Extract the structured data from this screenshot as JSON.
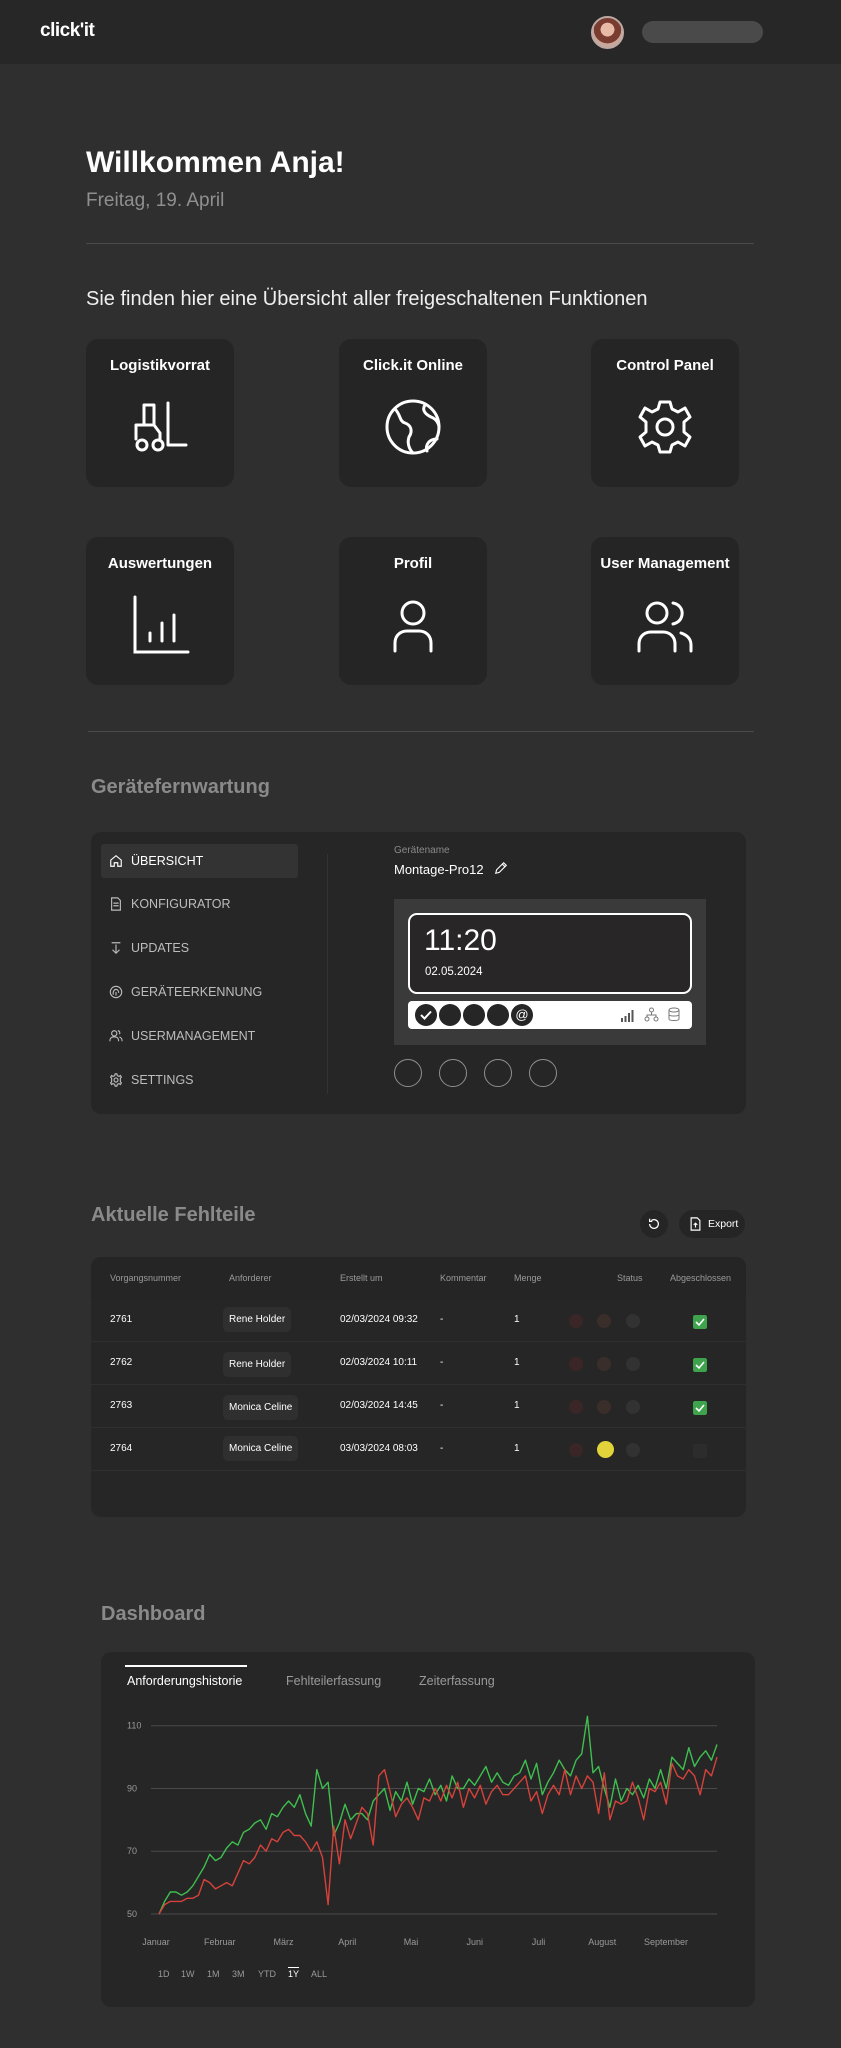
{
  "header": {
    "logo": "click'it",
    "user_pill": ""
  },
  "welcome": {
    "title": "Willkommen Anja!",
    "date": "Freitag, 19. April",
    "intro": "Sie finden hier eine Übersicht aller freigeschaltenen Funktionen"
  },
  "tiles": [
    {
      "label": "Logistikvorrat",
      "icon": "forklift-icon"
    },
    {
      "label": "Click.it Online",
      "icon": "globe-icon"
    },
    {
      "label": "Control Panel",
      "icon": "gear-icon"
    },
    {
      "label": "Auswertungen",
      "icon": "bar-chart-icon"
    },
    {
      "label": "Profil",
      "icon": "user-icon"
    },
    {
      "label": "User Management",
      "icon": "users-icon"
    }
  ],
  "remote": {
    "title": "Gerätefernwartung",
    "menu": [
      {
        "label": "ÜBERSICHT",
        "icon": "home-icon",
        "active": true
      },
      {
        "label": "KONFIGURATOR",
        "icon": "document-icon",
        "active": false
      },
      {
        "label": "UPDATES",
        "icon": "download-icon",
        "active": false
      },
      {
        "label": "GERÄTEERKENNUNG",
        "icon": "fingerprint-icon",
        "active": false
      },
      {
        "label": "USERMANAGEMENT",
        "icon": "users-icon",
        "active": false
      },
      {
        "label": "SETTINGS",
        "icon": "gear-icon",
        "active": false
      }
    ],
    "device_label": "Gerätename",
    "device_name": "Montage-Pro12",
    "clock_time": "11:20",
    "clock_date": "02.05.2024",
    "status_at": "@"
  },
  "parts": {
    "title": "Aktuelle Fehlteile",
    "export_label": "Export",
    "columns": [
      "Vorgangsnummer",
      "Anforderer",
      "Erstellt um",
      "Kommentar",
      "Menge",
      "Status",
      "Abgeschlossen"
    ],
    "rows": [
      {
        "id": "2761",
        "requester": "Rene Holder",
        "created": "02/03/2024 09:32",
        "comment": "-",
        "qty": "1",
        "status": "none",
        "done": true
      },
      {
        "id": "2762",
        "requester": "Rene Holder",
        "created": "02/03/2024 10:11",
        "comment": "-",
        "qty": "1",
        "status": "none",
        "done": true
      },
      {
        "id": "2763",
        "requester": "Monica Celine",
        "created": "02/03/2024 14:45",
        "comment": "-",
        "qty": "1",
        "status": "none",
        "done": true
      },
      {
        "id": "2764",
        "requester": "Monica Celine",
        "created": "03/03/2024 08:03",
        "comment": "-",
        "qty": "1",
        "status": "yellow",
        "done": false
      }
    ],
    "colors": {
      "check": "#3fa34d",
      "yellow": "#e3d33a"
    }
  },
  "dashboard": {
    "title": "Dashboard",
    "tabs": [
      "Anforderungshistorie",
      "Fehlteilerfassung",
      "Zeiterfassung"
    ],
    "ranges": [
      "1D",
      "1W",
      "1M",
      "3M",
      "YTD",
      "1Y",
      "ALL"
    ],
    "active_range": "1Y"
  },
  "chart_data": {
    "type": "line",
    "x_labels": [
      "Januar",
      "Februar",
      "März",
      "April",
      "Mai",
      "Juni",
      "Juli",
      "August",
      "September"
    ],
    "ylim": [
      50,
      115
    ],
    "yticks": [
      50,
      70,
      90,
      110
    ],
    "grid": true,
    "series": [
      {
        "color": "#3fbf4f",
        "values": [
          50,
          54,
          57,
          57,
          56,
          57,
          59,
          62,
          65,
          69,
          67,
          68,
          71,
          73,
          72,
          76,
          77,
          79,
          80,
          77,
          82,
          81,
          84,
          86,
          84,
          88,
          82,
          78,
          96,
          90,
          92,
          75,
          79,
          85,
          80,
          82,
          82,
          80,
          86,
          88,
          90,
          83,
          89,
          86,
          92,
          85,
          90,
          89,
          93,
          88,
          91,
          86,
          94,
          90,
          90,
          93,
          91,
          94,
          97,
          92,
          95,
          92,
          91,
          94,
          95,
          99,
          93,
          98,
          88,
          92,
          95,
          99,
          96,
          94,
          99,
          101,
          113,
          95,
          97,
          90,
          84,
          93,
          86,
          90,
          88,
          91,
          87,
          93,
          90,
          96,
          90,
          100,
          98,
          96,
          103,
          97,
          100,
          102,
          99,
          104
        ]
      },
      {
        "color": "#d6423b",
        "values": [
          50,
          53,
          54,
          54,
          54,
          55,
          55,
          56,
          61,
          60,
          58,
          59,
          60,
          59,
          63,
          67,
          66,
          68,
          72,
          70,
          74,
          73,
          76,
          77,
          75,
          75,
          73,
          70,
          73,
          68,
          53,
          78,
          66,
          80,
          74,
          79,
          84,
          82,
          72,
          94,
          96,
          89,
          81,
          85,
          87,
          84,
          80,
          87,
          86,
          90,
          86,
          91,
          87,
          92,
          84,
          90,
          87,
          91,
          85,
          89,
          91,
          88,
          88,
          90,
          92,
          94,
          86,
          89,
          82,
          88,
          91,
          88,
          96,
          88,
          94,
          90,
          94,
          92,
          82,
          95,
          80,
          86,
          85,
          86,
          92,
          87,
          80,
          90,
          89,
          92,
          85,
          98,
          94,
          93,
          96,
          94,
          88,
          96,
          94,
          100
        ]
      }
    ]
  }
}
